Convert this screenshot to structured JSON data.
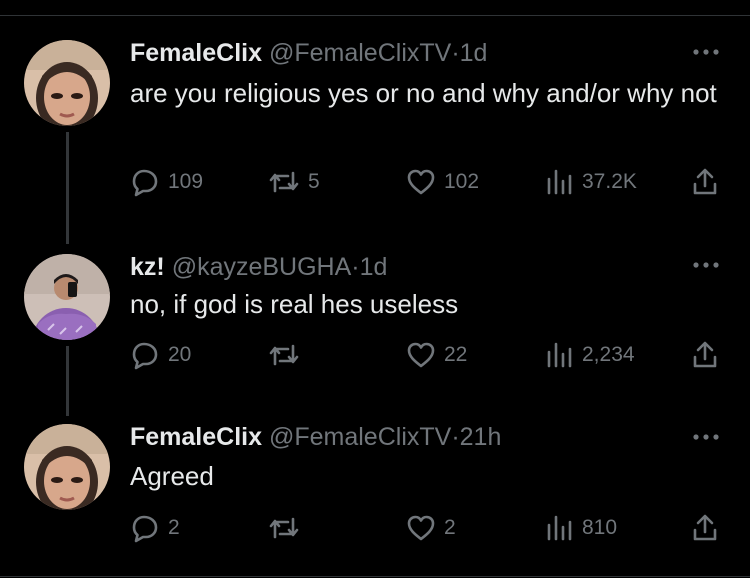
{
  "tweets": [
    {
      "name": "FemaleClix",
      "handle": "@FemaleClixTV",
      "separator": "·",
      "time": "1d",
      "text": "are you religious yes or no and why and/or why not",
      "replies": "109",
      "reposts": "5",
      "likes": "102",
      "views": "37.2K",
      "avatar_icon": "profile-photo"
    },
    {
      "name": "kz!",
      "handle": "@kayzeBUGHA",
      "separator": "·",
      "time": "1d",
      "text": "no, if god is real hes useless",
      "replies": "20",
      "reposts": "",
      "likes": "22",
      "views": "2,234",
      "avatar_icon": "profile-photo"
    },
    {
      "name": "FemaleClix",
      "handle": "@FemaleClixTV",
      "separator": "·",
      "time": "21h",
      "text": "Agreed",
      "replies": "2",
      "reposts": "",
      "likes": "2",
      "views": "810",
      "avatar_icon": "profile-photo"
    }
  ],
  "colors": {
    "background": "#000000",
    "text_primary": "#e7e9ea",
    "text_secondary": "#71767b",
    "divider": "#2f3336",
    "thread_line": "#333639"
  },
  "icons": {
    "more": "more-dots-icon",
    "reply": "reply-bubble-icon",
    "repost": "repost-arrows-icon",
    "like": "heart-icon",
    "views": "views-bars-icon",
    "share": "share-upload-icon"
  }
}
